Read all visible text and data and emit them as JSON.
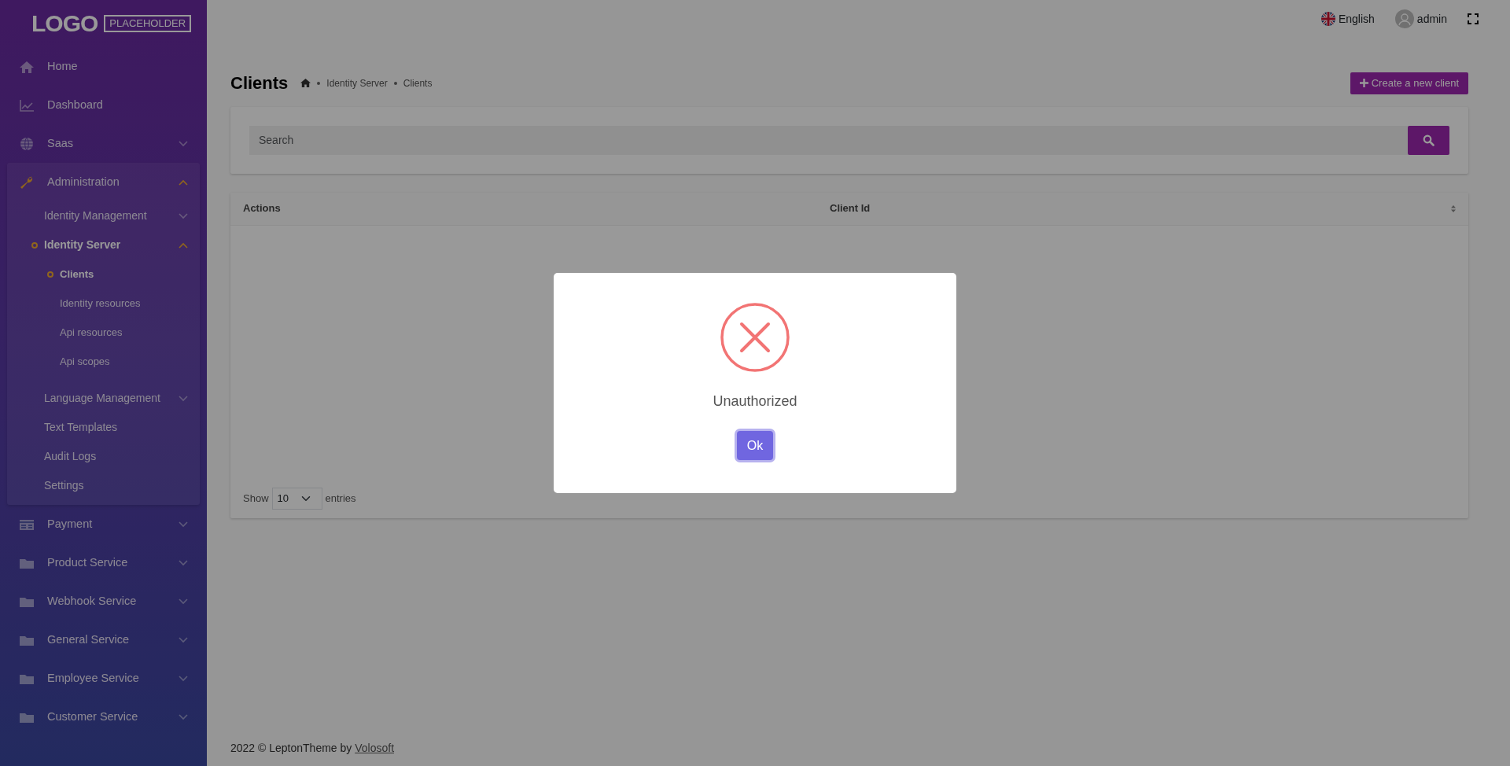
{
  "sidebar": {
    "logo": {
      "word": "LOGO",
      "tag": "PLACEHOLDER"
    },
    "items": [
      {
        "label": "Home",
        "selected": false
      },
      {
        "label": "Dashboard",
        "selected": false
      },
      {
        "label": "Saas",
        "expanded": false,
        "selected": false
      },
      {
        "label": "Administration",
        "expanded": true,
        "selected": true,
        "children": [
          {
            "label": "Identity Management",
            "expanded": false,
            "selected": false
          },
          {
            "label": "Identity Server",
            "expanded": true,
            "selected": true,
            "children": [
              {
                "label": "Clients",
                "selected": true
              },
              {
                "label": "Identity resources",
                "selected": false
              },
              {
                "label": "Api resources",
                "selected": false
              },
              {
                "label": "Api scopes",
                "selected": false
              }
            ]
          },
          {
            "label": "Language Management",
            "expanded": false,
            "selected": false
          },
          {
            "label": "Text Templates",
            "selected": false
          },
          {
            "label": "Audit Logs",
            "selected": false
          },
          {
            "label": "Settings",
            "selected": false
          }
        ]
      },
      {
        "label": "Payment",
        "expanded": false,
        "selected": false
      },
      {
        "label": "Product Service",
        "expanded": false,
        "selected": false
      },
      {
        "label": "Webhook Service",
        "expanded": false,
        "selected": false
      },
      {
        "label": "General Service",
        "expanded": false,
        "selected": false
      },
      {
        "label": "Employee Service",
        "expanded": false,
        "selected": false
      },
      {
        "label": "Customer Service",
        "expanded": false,
        "selected": false
      }
    ]
  },
  "topbar": {
    "language": "English",
    "user": "admin"
  },
  "page": {
    "title": "Clients",
    "breadcrumb": [
      "Identity Server",
      "Clients"
    ],
    "create_button": "Create a new client"
  },
  "search": {
    "placeholder": "Search"
  },
  "table": {
    "columns": [
      "Actions",
      "Client Id"
    ],
    "show_label": "Show",
    "page_size": "10",
    "entries_label": "entries"
  },
  "footer": {
    "text": "2022 © LeptonTheme by",
    "link": "Volosoft"
  },
  "modal": {
    "message": "Unauthorized",
    "button": "Ok"
  }
}
